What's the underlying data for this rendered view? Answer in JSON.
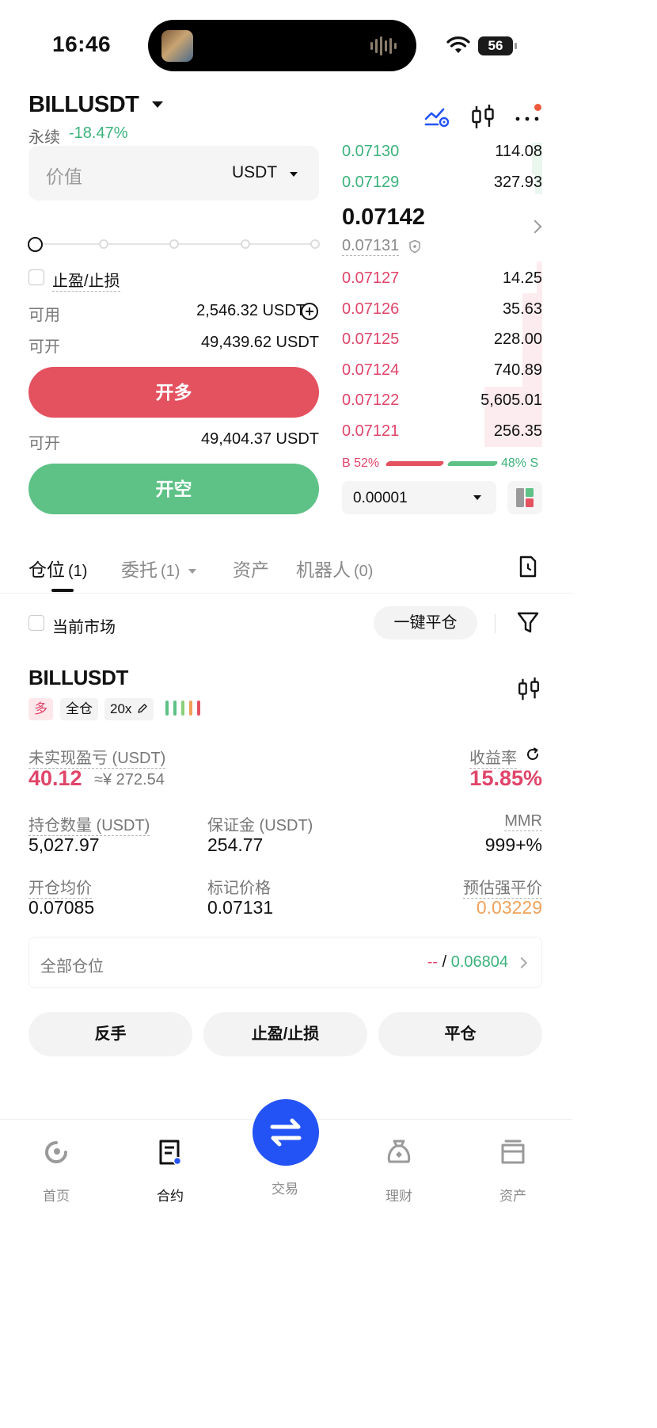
{
  "status_bar": {
    "time": "16:46",
    "battery": "56"
  },
  "header": {
    "pair": "BILLUSDT",
    "perp_label": "永续",
    "change": "-18.47%"
  },
  "trade_panel": {
    "value_placeholder": "价值",
    "value_unit": "USDT",
    "slider_percent": 0,
    "tpsl_label": "止盈/止损",
    "available_label": "可用",
    "available_value": "2,546.32 USDT",
    "open_long_label": "可开",
    "open_long_value": "49,439.62 USDT",
    "long_button": "开多",
    "open_short_label": "可开",
    "open_short_value": "49,404.37 USDT",
    "short_button": "开空"
  },
  "order_book": {
    "asks": [
      {
        "price": "0.07130",
        "qty": "114.08"
      },
      {
        "price": "0.07129",
        "qty": "327.93"
      }
    ],
    "last_price": "0.07142",
    "mark_price": "0.07131",
    "bids": [
      {
        "price": "0.07127",
        "qty": "14.25"
      },
      {
        "price": "0.07126",
        "qty": "35.63"
      },
      {
        "price": "0.07125",
        "qty": "228.00"
      },
      {
        "price": "0.07124",
        "qty": "740.89"
      },
      {
        "price": "0.07122",
        "qty": "5,605.01"
      },
      {
        "price": "0.07121",
        "qty": "256.35"
      }
    ],
    "buy_ratio": "B 52%",
    "sell_ratio": "48% S",
    "precision": "0.00001"
  },
  "tabs": [
    {
      "label": "仓位",
      "count": "(1)"
    },
    {
      "label": "委托",
      "count": "(1)"
    },
    {
      "label": "资产",
      "count": ""
    },
    {
      "label": "机器人",
      "count": "(0)"
    }
  ],
  "filters": {
    "current_market": "当前市场",
    "close_all": "一键平仓"
  },
  "position": {
    "symbol": "BILLUSDT",
    "direction": "多",
    "margin_mode": "全仓",
    "leverage": "20x",
    "unrealized_pnl_label": "未实现盈亏 (USDT)",
    "unrealized_pnl": "40.12",
    "unrealized_pnl_cny": "≈¥ 272.54",
    "roe_label": "收益率",
    "roe": "15.85%",
    "size_label": "持仓数量 (USDT)",
    "size": "5,027.97",
    "margin_label": "保证金 (USDT)",
    "margin": "254.77",
    "mmr_label": "MMR",
    "mmr": "999+%",
    "entry_label": "开仓均价",
    "entry": "0.07085",
    "mark_label": "标记价格",
    "mark": "0.07131",
    "liq_label": "预估强平价",
    "liq": "0.03229"
  },
  "all_positions": {
    "label": "全部仓位",
    "value_neg": "--",
    "separator": "/",
    "value_pos": "0.06804"
  },
  "actions": {
    "reverse": "反手",
    "tpsl": "止盈/止损",
    "close": "平仓"
  },
  "bottom_nav": [
    {
      "label": "首页"
    },
    {
      "label": "合约"
    },
    {
      "label": "交易"
    },
    {
      "label": "理财"
    },
    {
      "label": "资产"
    }
  ],
  "colors": {
    "green": "#3bb27a",
    "red": "#e0456a",
    "orange": "#f0a25a",
    "blue": "#2453f5"
  }
}
